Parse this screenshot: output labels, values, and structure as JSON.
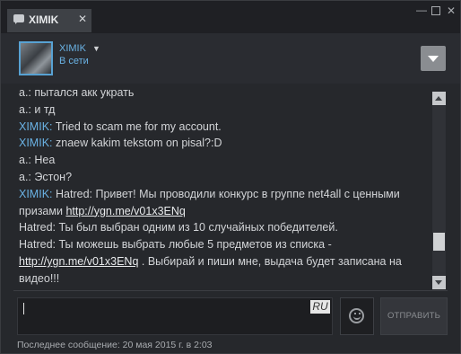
{
  "window": {
    "tab_title": "XIMIK",
    "tab_close": "✕",
    "minimize": "—",
    "close": "✕"
  },
  "header": {
    "username": "XIMIK",
    "status": "В сети"
  },
  "messages": [
    {
      "author": "a.:",
      "author_color": "#d2d4d7",
      "text": "пытался акк украть"
    },
    {
      "author": "a.:",
      "author_color": "#d2d4d7",
      "text": "и тд"
    },
    {
      "author": "XIMIK:",
      "author_color": "#6ab2e4",
      "text": "Tried to scam me for my account."
    },
    {
      "author": "XIMIK:",
      "author_color": "#6ab2e4",
      "text": "znaew kakim tekstom on pisal?:D"
    },
    {
      "author": "a.:",
      "author_color": "#d2d4d7",
      "text": "Неа"
    },
    {
      "author": "a.:",
      "author_color": "#d2d4d7",
      "text": "Эстон?"
    },
    {
      "author": "XIMIK:",
      "author_color": "#6ab2e4",
      "text": "Hatred: Привет! Мы проводили конкурс в группе net4all с ценными призами ",
      "link": "http://ygn.me/v01x3ENq"
    },
    {
      "author": "",
      "author_color": "#d2d4d7",
      "text": "Hatred: Ты был выбран одним из 10 случайных победителей."
    },
    {
      "author": "",
      "author_color": "#d2d4d7",
      "text": "Hatred: Ты можешь выбрать любые 5 предметов из списка - ",
      "link": "http://ygn.me/v01x3ENq",
      "after": " . Выбирай и пиши мне, выдача будет записана на видео!!!"
    }
  ],
  "input": {
    "language": "RU"
  },
  "send_label": "ОТПРАВИТЬ",
  "footer": "Последнее сообщение: 20 мая 2015 г. в 2:03",
  "colors": {
    "accent": "#6ab2e4",
    "background": "#26282c"
  }
}
